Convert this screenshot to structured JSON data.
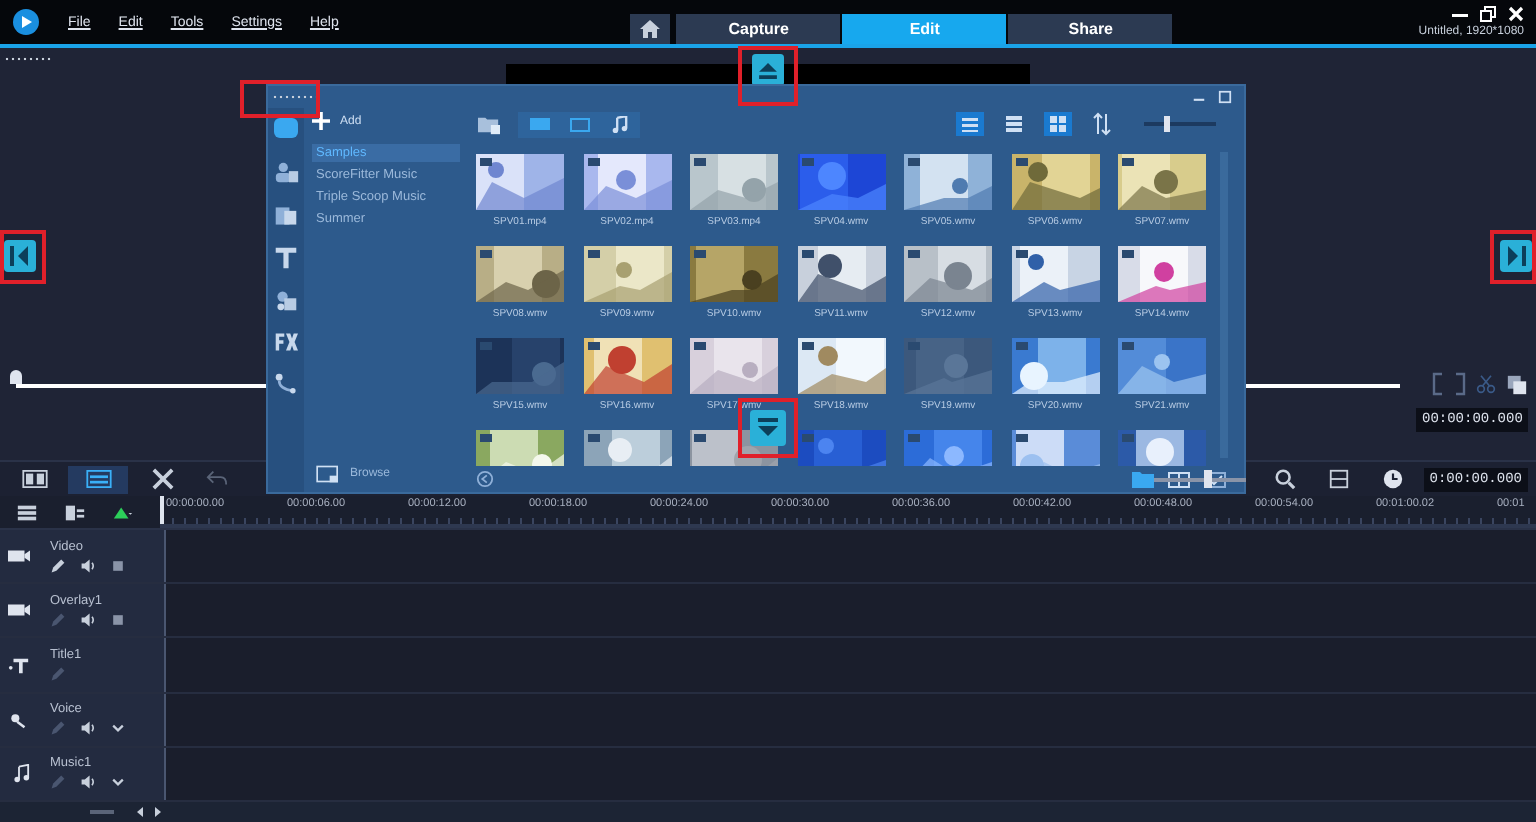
{
  "app_bar": {
    "menu": [
      "File",
      "Edit",
      "Tools",
      "Settings",
      "Help"
    ],
    "tabs": [
      {
        "label": "Capture",
        "selected": false
      },
      {
        "label": "Edit",
        "selected": true
      },
      {
        "label": "Share",
        "selected": false
      }
    ],
    "project": "Untitled, 1920*1080"
  },
  "player": {
    "level": 0,
    "timecode": "00:00:00.000"
  },
  "library": {
    "add_label": "Add",
    "browse_label": "Browse",
    "size": {
      "level": 0.3
    },
    "folders": [
      {
        "label": "Samples",
        "selected": true
      },
      {
        "label": "ScoreFitter Music",
        "selected": false
      },
      {
        "label": "Triple Scoop Music",
        "selected": false
      },
      {
        "label": "Summer",
        "selected": false
      }
    ],
    "thumbnails": [
      {
        "kind": "clip",
        "name": "SPV01.mp4"
      },
      {
        "kind": "clip",
        "name": "SPV02.mp4"
      },
      {
        "kind": "clip",
        "name": "SPV03.mp4"
      },
      {
        "kind": "clip",
        "name": "SPV04.wmv"
      },
      {
        "kind": "clip",
        "name": "SPV05.wmv"
      },
      {
        "kind": "clip",
        "name": "SPV06.wmv"
      },
      {
        "kind": "clip",
        "name": "SPV07.wmv"
      },
      {
        "kind": "clip",
        "name": "SPV08.wmv"
      },
      {
        "kind": "clip",
        "name": "SPV09.wmv"
      },
      {
        "kind": "clip",
        "name": "SPV10.wmv"
      },
      {
        "kind": "clip",
        "name": "SPV11.wmv"
      },
      {
        "kind": "clip",
        "name": "SPV12.wmv"
      },
      {
        "kind": "clip",
        "name": "SPV13.wmv"
      },
      {
        "kind": "clip",
        "name": "SPV14.wmv"
      },
      {
        "kind": "clip",
        "name": "SPV15.wmv"
      },
      {
        "kind": "clip",
        "name": "SPV16.wmv"
      },
      {
        "kind": "clip",
        "name": "SPV17.wmv"
      },
      {
        "kind": "clip",
        "name": "SPV18.wmv"
      },
      {
        "kind": "clip",
        "name": "SPV19.wmv"
      },
      {
        "kind": "clip",
        "name": "SPV20.wmv"
      },
      {
        "kind": "clip",
        "name": "SPV21.wmv"
      },
      {
        "kind": "clip"
      },
      {
        "kind": "clip"
      },
      {
        "kind": "clip"
      },
      {
        "kind": "clip"
      },
      {
        "kind": "clip"
      },
      {
        "kind": "clip"
      },
      {
        "kind": "clip"
      }
    ]
  },
  "timeline": {
    "zoom": {
      "level": 0.6
    },
    "timecode": "0:00:00.000",
    "ruler": [
      "00:00:00.00",
      "00:00:06.00",
      "00:00:12.00",
      "00:00:18.00",
      "00:00:24.00",
      "00:00:30.00",
      "00:00:36.00",
      "00:00:42.00",
      "00:00:48.00",
      "00:00:54.00",
      "00:01:00.02",
      "00:01"
    ],
    "tracks": [
      {
        "name": "Video",
        "kind": "video"
      },
      {
        "name": "Overlay1",
        "kind": "overlay"
      },
      {
        "name": "Title1",
        "kind": "title"
      },
      {
        "name": "Voice",
        "kind": "voice"
      },
      {
        "name": "Music1",
        "kind": "music"
      }
    ]
  }
}
